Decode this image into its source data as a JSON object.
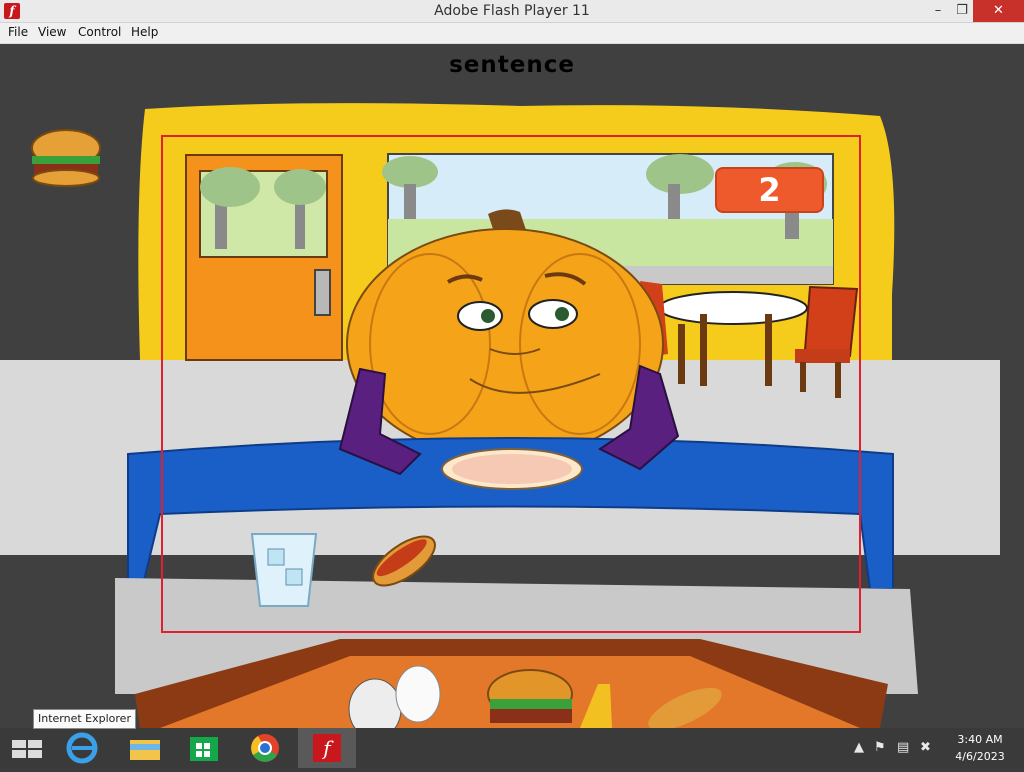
{
  "window": {
    "title": "Adobe Flash Player 11",
    "icon": "flash-icon",
    "controls": {
      "minimize": "–",
      "maximize": "❐",
      "close": "✕"
    }
  },
  "menu": [
    "File",
    "View",
    "Control",
    "Help"
  ],
  "game": {
    "title": "sentence",
    "score": "2",
    "highlight_color": "#e0202c"
  },
  "taskbar": {
    "tooltip": "Internet Explorer",
    "pinned": [
      "windows-start-icon",
      "internet-explorer-icon",
      "file-explorer-icon",
      "windows-store-icon",
      "chrome-icon",
      "flash-player-icon"
    ],
    "clock_time": "3:40 AM",
    "clock_date": "4/6/2023"
  }
}
